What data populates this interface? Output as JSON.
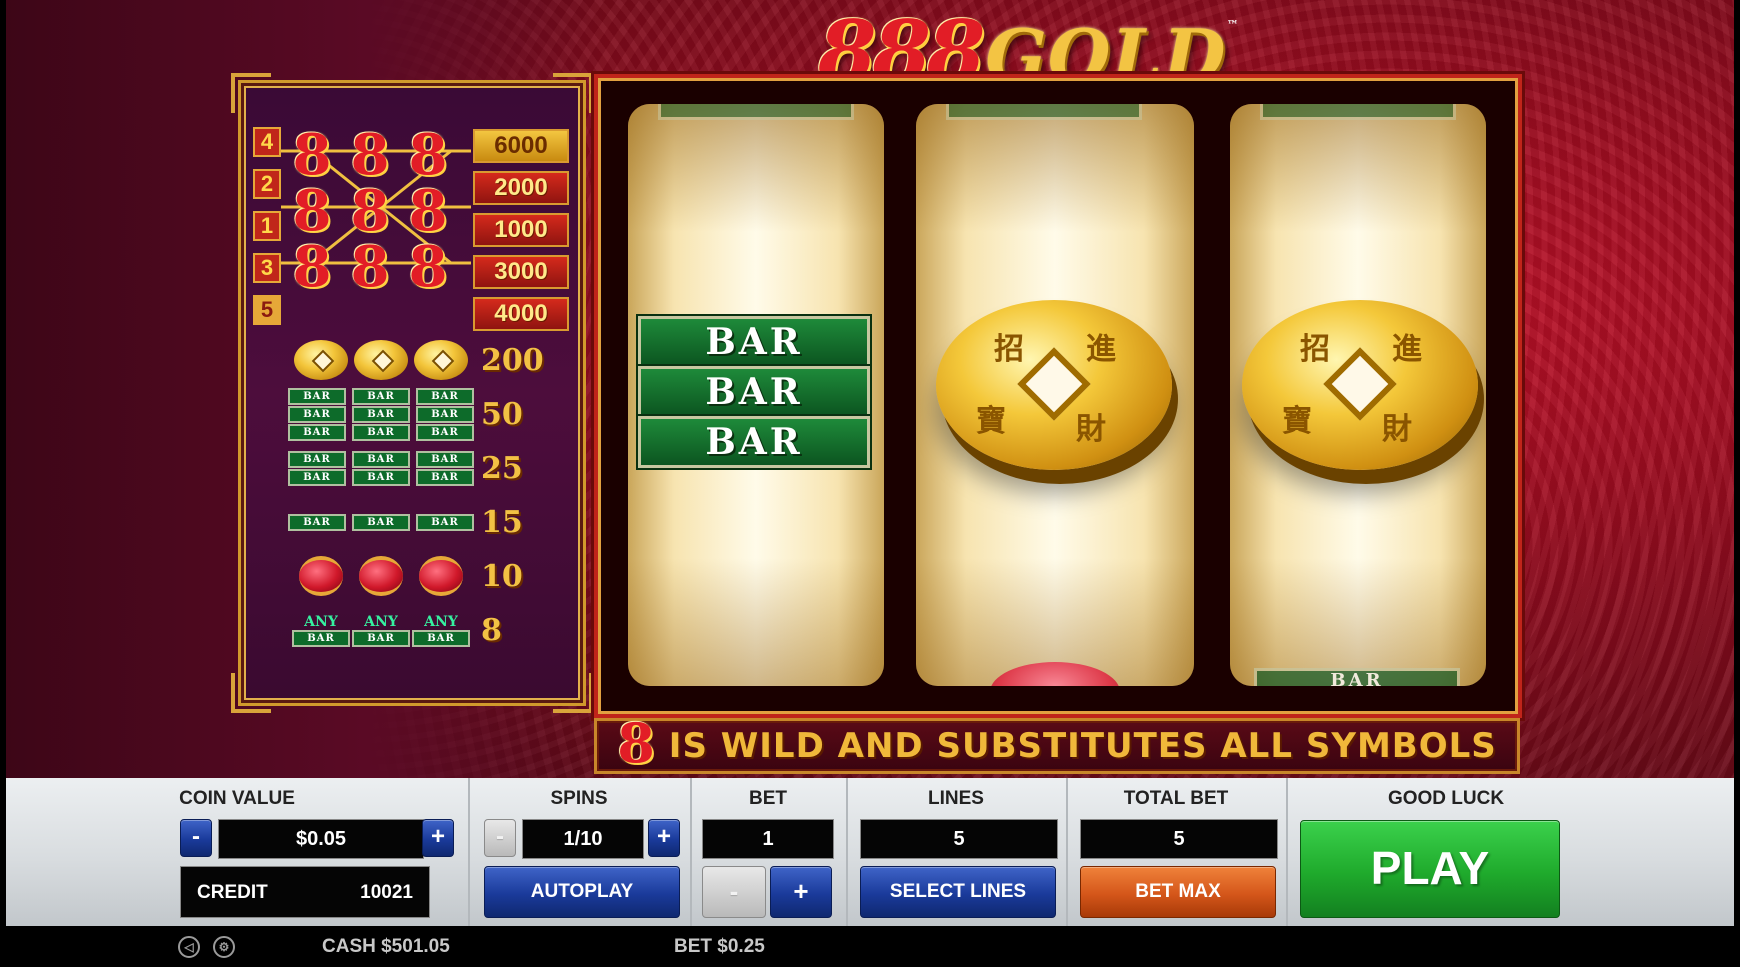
{
  "game": {
    "logo_eights": "888",
    "logo_gold": "GOLD",
    "logo_tm": "™"
  },
  "paytable": {
    "line_numbers": [
      "4",
      "2",
      "1",
      "3",
      "5"
    ],
    "line_payouts": [
      "6000",
      "2000",
      "1000",
      "3000",
      "4000"
    ],
    "wild_symbol": "8",
    "rows": [
      {
        "symbol": "coin",
        "payout": "200"
      },
      {
        "symbol": "triple-bar",
        "bar_text": "BAR",
        "payout": "50"
      },
      {
        "symbol": "double-bar",
        "bar_text": "BAR",
        "payout": "25"
      },
      {
        "symbol": "single-bar",
        "bar_text": "BAR",
        "payout": "15"
      },
      {
        "symbol": "lantern",
        "payout": "10"
      },
      {
        "symbol": "any-bar",
        "any_text": "ANY",
        "bar_text": "BAR",
        "payout": "8"
      }
    ]
  },
  "reels": {
    "reel1": {
      "symbol": "triple-bar",
      "bar_text": "BAR"
    },
    "reel2": {
      "symbol": "gold-coin"
    },
    "reel3": {
      "symbol": "gold-coin"
    },
    "coin_chars": [
      "招",
      "進",
      "寶",
      "財"
    ],
    "partial_bottom_bar_text": "BAR"
  },
  "wild_banner": {
    "symbol": "8",
    "text": "IS WILD AND SUBSTITUTES ALL SYMBOLS"
  },
  "controls": {
    "coin_value": {
      "label": "COIN VALUE",
      "value": "$0.05",
      "minus": "-",
      "plus": "+"
    },
    "credit": {
      "label": "CREDIT",
      "value": "10021"
    },
    "spins": {
      "label": "SPINS",
      "value": "1/10",
      "minus": "-",
      "plus": "+",
      "autoplay": "AUTOPLAY"
    },
    "bet": {
      "label": "BET",
      "value": "1",
      "minus": "-",
      "plus": "+"
    },
    "lines": {
      "label": "LINES",
      "value": "5",
      "select": "SELECT LINES"
    },
    "total_bet": {
      "label": "TOTAL BET",
      "value": "5",
      "bet_max": "BET MAX"
    },
    "play": {
      "label": "GOOD LUCK",
      "button": "PLAY"
    }
  },
  "status_bar": {
    "back_icon": "◁",
    "settings_icon": "⚙",
    "cash": "CASH  $501.05",
    "bet": "BET  $0.25"
  },
  "colors": {
    "accent_red": "#e21d26",
    "gold": "#f3c443",
    "play_green": "#1faa2c",
    "button_blue": "#1a3a9a",
    "bet_max_orange": "#d4561a"
  }
}
